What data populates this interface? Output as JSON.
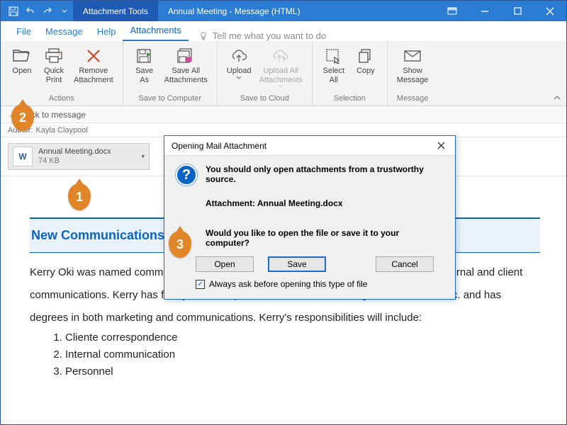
{
  "titlebar": {
    "contextTab": "Attachment Tools",
    "title": "Annual Meeting  -  Message (HTML)"
  },
  "tabs": {
    "file": "File",
    "message": "Message",
    "help": "Help",
    "attachments": "Attachments",
    "tellMe": "Tell me what you want to do"
  },
  "ribbon": {
    "actions": {
      "open": "Open",
      "quickPrint": "Quick\nPrint",
      "remove": "Remove\nAttachment",
      "label": "Actions"
    },
    "saveComputer": {
      "saveAs": "Save\nAs",
      "saveAll": "Save All\nAttachments",
      "label": "Save to Computer"
    },
    "saveCloud": {
      "upload": "Upload",
      "uploadAll": "Upload All\nAttachments",
      "label": "Save to Cloud"
    },
    "selection": {
      "selectAll": "Select\nAll",
      "copy": "Copy",
      "label": "Selection"
    },
    "message": {
      "showMessage": "Show\nMessage",
      "label": "Message"
    }
  },
  "backbar": {
    "text": "Back to message"
  },
  "authorbar": {
    "label": "Author:",
    "name": "Kayla Claypool"
  },
  "attachment": {
    "name": "Annual Meeting.docx",
    "size": "74 KB"
  },
  "mail": {
    "heading": "New Communications Director",
    "para": "Kerry Oki was named communications director and will coordinate and direct all formal internal and client communications. Kerry has four years of experience as an office manager at Luna Sea, Inc. and has degrees in both marketing and communications. Kerry's responsibilities will include:",
    "li1": "Cliente correspondence",
    "li2": "Internal communication",
    "li3": "Personnel"
  },
  "dialog": {
    "title": "Opening Mail Attachment",
    "warn": "You should only open attachments from a trustworthy source.",
    "attLabel": "Attachment: Annual Meeting.docx",
    "question": "Would you like to open the file or save it to your computer?",
    "open": "Open",
    "save": "Save",
    "cancel": "Cancel",
    "always": "Always ask before opening this type of file"
  },
  "badges": {
    "b1": "1",
    "b2": "2",
    "b3": "3"
  }
}
